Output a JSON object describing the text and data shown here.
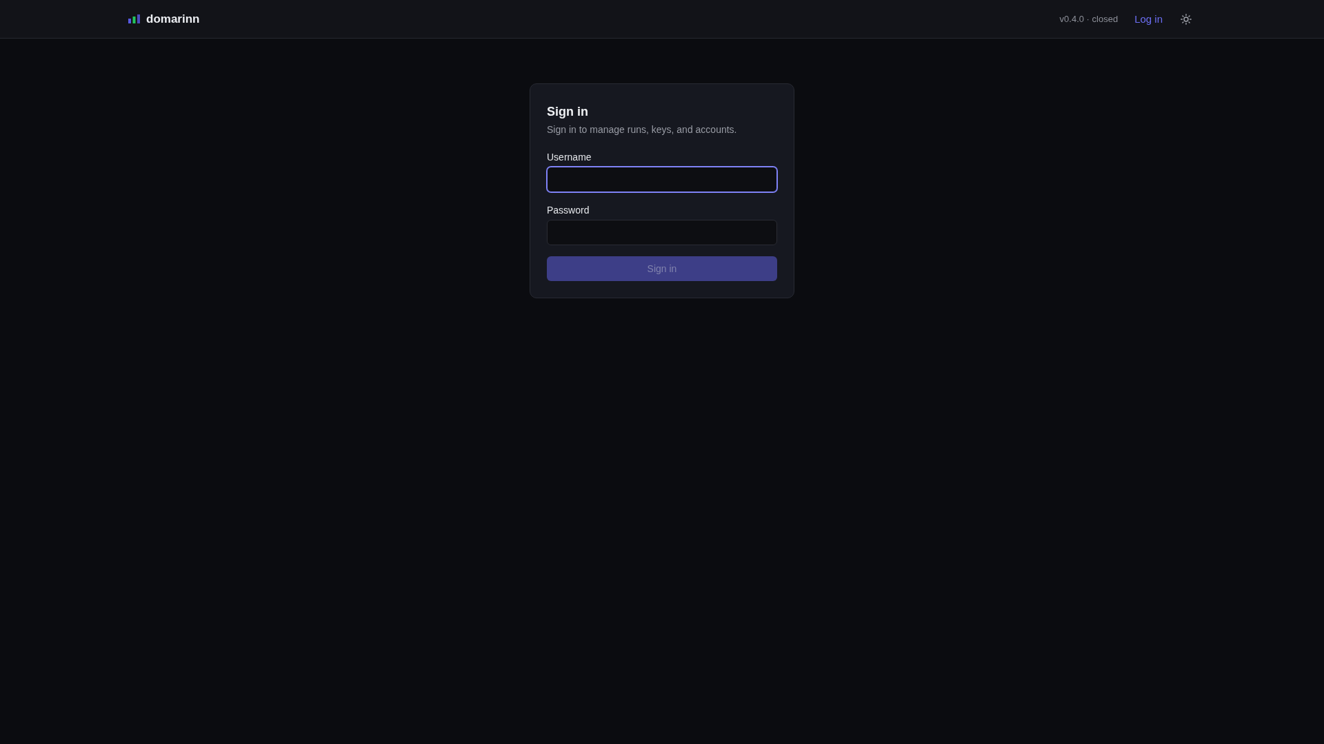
{
  "header": {
    "brand": "domarinn",
    "version": "v0.4.0 · closed",
    "login_link": "Log in"
  },
  "card": {
    "title": "Sign in",
    "subtitle": "Sign in to manage runs, keys, and accounts.",
    "fields": [
      {
        "label": "Username",
        "focused": true
      },
      {
        "label": "Password",
        "focused": false
      }
    ],
    "submit": {
      "label": "Sign in",
      "disabled": true
    }
  }
}
